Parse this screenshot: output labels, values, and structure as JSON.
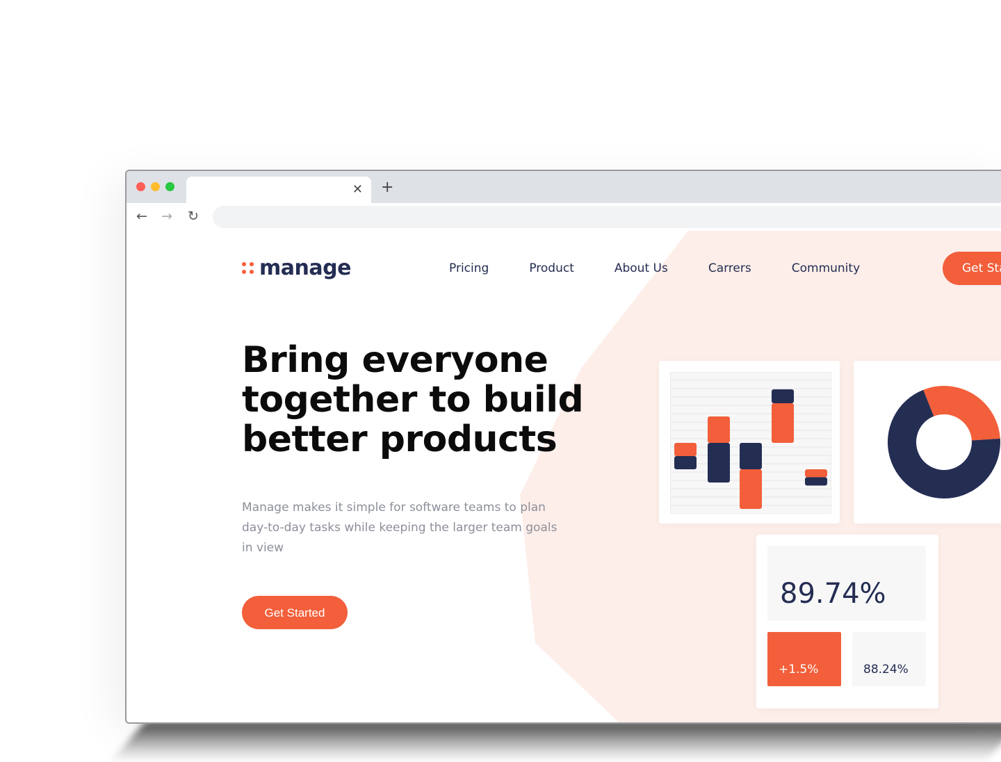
{
  "colors": {
    "accent": "#f25f3a",
    "navy": "#242d52",
    "blob": "#fdeee9"
  },
  "browser": {
    "new_tab_icon": "plus-icon",
    "close_tab_icon": "close-icon"
  },
  "header": {
    "logo_text": "manage",
    "nav": [
      "Pricing",
      "Product",
      "About Us",
      "Carrers",
      "Community"
    ],
    "cta_label": "Get Started"
  },
  "hero": {
    "title": "Bring everyone together to build better products",
    "subtitle": "Manage makes it simple for software teams to plan day-to-day tasks while keeping the larger team goals in view",
    "cta_label": "Get Started"
  },
  "stats": {
    "big": "89.74%",
    "change": "+1.5%",
    "small": "88.24%"
  },
  "chart_data": [
    {
      "type": "bar",
      "series": [
        {
          "name": "",
          "values": [
            [
              -0.5,
              0,
              -1.0
            ],
            [
              1.0,
              0,
              -1.5
            ],
            [
              0,
              -1.0,
              -2.5
            ],
            [
              1.5,
              1.5,
              0
            ],
            [
              -1.3,
              -1.0,
              0
            ]
          ]
        }
      ],
      "colors": [
        "#f25f3a",
        "#242d52"
      ],
      "grid": true
    },
    {
      "type": "pie",
      "values": [
        30,
        70
      ],
      "colors": [
        "#f25f3a",
        "#242d52"
      ],
      "donut": true
    }
  ]
}
